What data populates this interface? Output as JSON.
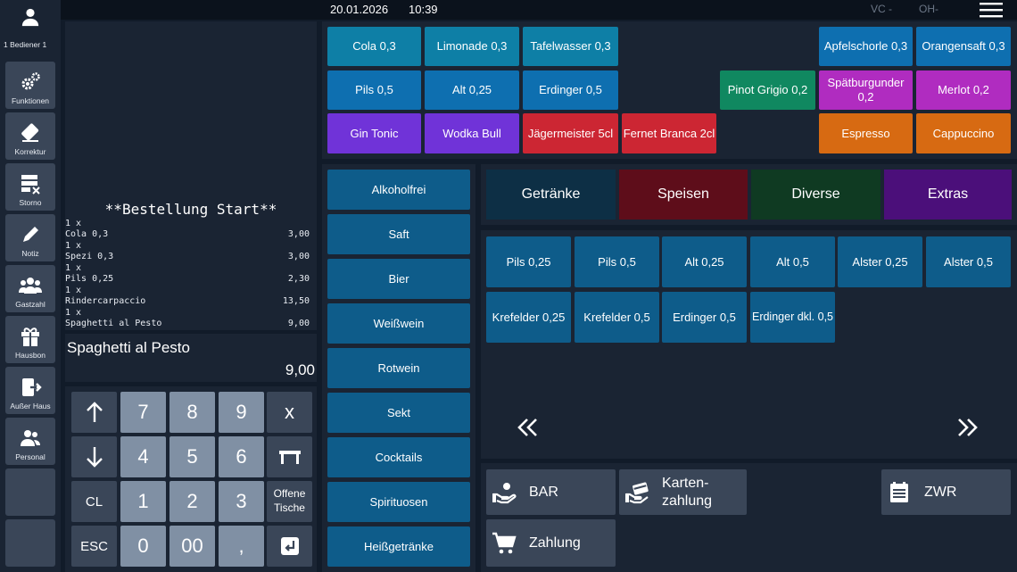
{
  "user": {
    "label": "1  Bediener 1"
  },
  "sidebar": {
    "items": [
      {
        "label": "Funktionen",
        "icon": "gears-icon"
      },
      {
        "label": "Korrektur",
        "icon": "eraser-icon"
      },
      {
        "label": "Storno",
        "icon": "storno-icon"
      },
      {
        "label": "Notiz",
        "icon": "pencil-icon"
      },
      {
        "label": "Gastzahl",
        "icon": "group-icon"
      },
      {
        "label": "Hausbon",
        "icon": "gift-icon"
      },
      {
        "label": "Außer Haus",
        "icon": "exit-icon"
      },
      {
        "label": "Personal",
        "icon": "staff-icon"
      }
    ]
  },
  "topbar": {
    "date": "20.01.2026",
    "time": "10:39",
    "vc": "VC -",
    "oh": "OH-"
  },
  "receipt": {
    "title": "**Bestellung Start**",
    "lines": [
      {
        "qty": "1 x",
        "name": "Cola 0,3",
        "amount": "3,00"
      },
      {
        "qty": "1 x",
        "name": "Spezi 0,3",
        "amount": "3,00"
      },
      {
        "qty": "1 x",
        "name": "Pils 0,25",
        "amount": "2,30"
      },
      {
        "qty": "1 x",
        "name": "Rindercarpaccio",
        "amount": "13,50"
      },
      {
        "qty": "1 x",
        "name": "Spaghetti al Pesto",
        "amount": "9,00"
      }
    ]
  },
  "last_item": {
    "name": "Spaghetti al Pesto",
    "price": "9,00"
  },
  "keypad": {
    "keys": [
      "7",
      "8",
      "9",
      "x",
      "4",
      "5",
      "6",
      "1",
      "2",
      "3",
      "0",
      "00",
      ","
    ],
    "cl": "CL",
    "esc": "ESC",
    "open_tables_1": "Offene",
    "open_tables_2": "Tische"
  },
  "favorites": [
    {
      "label": "Cola 0,3",
      "color": "#0e7fa6"
    },
    {
      "label": "Limonade 0,3",
      "color": "#0e7fa6"
    },
    {
      "label": "Tafelwasser 0,3",
      "color": "#0e7fa6"
    },
    {
      "label": "Apfelschorle 0,3",
      "color": "#0e6fb0"
    },
    {
      "label": "Orangensaft 0,3",
      "color": "#0e6fb0"
    },
    {
      "label": "Pils 0,5",
      "color": "#0e6fb0"
    },
    {
      "label": "Alt 0,25",
      "color": "#0e6fb0"
    },
    {
      "label": "Erdinger 0,5",
      "color": "#0e6fb0"
    },
    {
      "label": "Pinot Grigio 0,2",
      "color": "#108860"
    },
    {
      "label": "Spätburgunder 0,2",
      "color": "#b02cc0"
    },
    {
      "label": "Merlot 0,2",
      "color": "#b02cc0"
    },
    {
      "label": "Gin Tonic",
      "color": "#7033d8"
    },
    {
      "label": "Wodka Bull",
      "color": "#7033d8"
    },
    {
      "label": "Jägermeister 5cl",
      "color": "#cc2633"
    },
    {
      "label": "Fernet Branca 2cl",
      "color": "#cc2633"
    },
    {
      "label": "Espresso",
      "color": "#d76a12"
    },
    {
      "label": "Cappuccino",
      "color": "#d76a12"
    }
  ],
  "categories": [
    "Alkoholfrei",
    "Saft",
    "Bier",
    "Weißwein",
    "Rotwein",
    "Sekt",
    "Cocktails",
    "Spirituosen",
    "Heißgetränke"
  ],
  "tabs": [
    {
      "label": "Getränke",
      "color": "#0d2f45"
    },
    {
      "label": "Speisen",
      "color": "#5e0d1a"
    },
    {
      "label": "Diverse",
      "color": "#0f3a22"
    },
    {
      "label": "Extras",
      "color": "#4b0f7a"
    }
  ],
  "products": [
    "Pils 0,25",
    "Pils 0,5",
    "Alt 0,25",
    "Alt 0,5",
    "Alster 0,25",
    "Alster 0,5",
    "Krefelder 0,25",
    "Krefelder 0,5",
    "Erdinger 0,5",
    "Erdinger dkl. 0,5"
  ],
  "payment": {
    "bar": "BAR",
    "card_1": "Karten-",
    "card_2": "zahlung",
    "zwr": "ZWR",
    "zahlung": "Zahlung"
  },
  "colors": {
    "category": "#0e5c8a",
    "product": "#0e5c8a",
    "keypad_num": "#8090a4",
    "keypad_fn": "#3a4658"
  }
}
